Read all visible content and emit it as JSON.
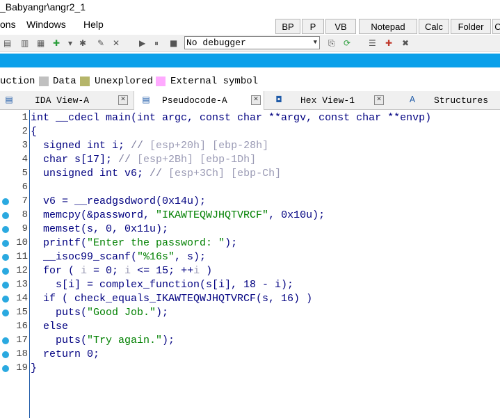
{
  "window": {
    "title": "_Babyangr\\angr2_1"
  },
  "menu": {
    "items": [
      "ons",
      "Windows",
      "Help"
    ]
  },
  "quick_buttons": [
    "BP",
    "P",
    "VB",
    "Notepad",
    "Calc",
    "Folder",
    "C"
  ],
  "toolbar": {
    "debugger_select": "No debugger"
  },
  "legend": {
    "items": [
      {
        "label": "uction",
        "color": ""
      },
      {
        "label": "Data",
        "color": "#c0c0c0"
      },
      {
        "label": "Unexplored",
        "color": "#b5b56a"
      },
      {
        "label": "External symbol",
        "color": "#ffaaff"
      }
    ]
  },
  "tabs": [
    {
      "label": "IDA View-A",
      "active": false
    },
    {
      "label": "Pseudocode-A",
      "active": true
    },
    {
      "label": "Hex View-1",
      "active": false
    },
    {
      "label": "Structures",
      "active": false
    }
  ],
  "code": {
    "lines": [
      {
        "n": "1",
        "bp": false,
        "text": "int __cdecl main(int argc, const char **argv, const char **envp)"
      },
      {
        "n": "2",
        "bp": false,
        "text": "{"
      },
      {
        "n": "3",
        "bp": false,
        "text": "  signed int i; // [esp+20h] [ebp-28h]"
      },
      {
        "n": "4",
        "bp": false,
        "text": "  char s[17]; // [esp+2Bh] [ebp-1Dh]"
      },
      {
        "n": "5",
        "bp": false,
        "text": "  unsigned int v6; // [esp+3Ch] [ebp-Ch]"
      },
      {
        "n": "6",
        "bp": false,
        "text": ""
      },
      {
        "n": "7",
        "bp": true,
        "text": "  v6 = __readgsdword(0x14u);"
      },
      {
        "n": "8",
        "bp": true,
        "text": "  memcpy(&password, \"IKAWTEQWJHQTVRCF\", 0x10u);"
      },
      {
        "n": "9",
        "bp": true,
        "text": "  memset(s, 0, 0x11u);"
      },
      {
        "n": "10",
        "bp": true,
        "text": "  printf(\"Enter the password: \");"
      },
      {
        "n": "11",
        "bp": true,
        "text": "  __isoc99_scanf(\"%16s\", s);"
      },
      {
        "n": "12",
        "bp": true,
        "text": "  for ( i = 0; i <= 15; ++i )"
      },
      {
        "n": "13",
        "bp": true,
        "text": "    s[i] = complex_function(s[i], 18 - i);"
      },
      {
        "n": "14",
        "bp": true,
        "text": "  if ( check_equals_IKAWTEQWJHQTVRCF(s, 16) )"
      },
      {
        "n": "15",
        "bp": true,
        "text": "    puts(\"Good Job.\");"
      },
      {
        "n": "16",
        "bp": false,
        "text": "  else"
      },
      {
        "n": "17",
        "bp": true,
        "text": "    puts(\"Try again.\");"
      },
      {
        "n": "18",
        "bp": true,
        "text": "  return 0;"
      },
      {
        "n": "19",
        "bp": true,
        "text": "}"
      }
    ]
  },
  "colors": {
    "accent": "#0aa0ea",
    "code_text": "#000080",
    "string": "#008000",
    "comment": "#7f7f9f",
    "breakpoint": "#2aa9e0"
  }
}
